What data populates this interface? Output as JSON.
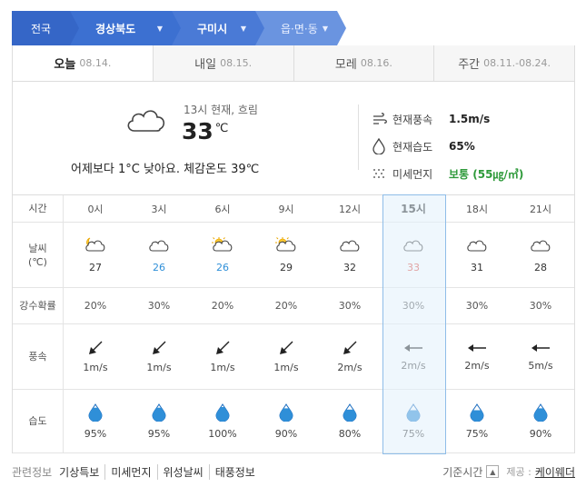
{
  "breadcrumb": {
    "home": "전국",
    "level1": "경상북도",
    "level2": "구미시",
    "level3": "읍·면·동"
  },
  "tabs": [
    {
      "label": "오늘",
      "date": "08.14."
    },
    {
      "label": "내일",
      "date": "08.15."
    },
    {
      "label": "모레",
      "date": "08.16."
    },
    {
      "label": "주간",
      "date": "08.11.-08.24."
    }
  ],
  "current": {
    "desc": "13시 현재, 흐림",
    "temp": "33",
    "unit": "℃",
    "compare": "어제보다 1°C 낮아요.  체감온도 39℃",
    "icon": "cloudy-icon"
  },
  "info": {
    "wind_label": "현재풍속",
    "wind_value": "1.5m/s",
    "humidity_label": "현재습도",
    "humidity_value": "65%",
    "dust_label": "미세먼지",
    "dust_value": "보통 (55㎍/㎥)"
  },
  "forecast": {
    "labels": {
      "time": "시간",
      "weather": "날씨\n(℃)",
      "rain": "강수확률",
      "wind": "풍속",
      "humidity": "습도"
    },
    "times": [
      "0시",
      "3시",
      "6시",
      "9시",
      "12시",
      "15시",
      "18시",
      "21시"
    ],
    "icons": [
      "cloudy-night-icon",
      "cloudy-icon",
      "partly-cloudy-icon",
      "partly-cloudy-icon",
      "cloudy-icon",
      "cloudy-icon",
      "cloudy-icon",
      "cloudy-icon"
    ],
    "temps": [
      "27",
      "26",
      "26",
      "29",
      "32",
      "33",
      "31",
      "28"
    ],
    "rain": [
      "20%",
      "30%",
      "20%",
      "20%",
      "30%",
      "30%",
      "30%",
      "30%"
    ],
    "wind_dir": [
      "sw",
      "sw",
      "sw",
      "sw",
      "sw",
      "w",
      "w",
      "w"
    ],
    "wind": [
      "1m/s",
      "1m/s",
      "1m/s",
      "1m/s",
      "2m/s",
      "2m/s",
      "2m/s",
      "5m/s"
    ],
    "humidity": [
      "95%",
      "95%",
      "100%",
      "90%",
      "80%",
      "75%",
      "75%",
      "90%"
    ],
    "humidity_level": [
      0.95,
      0.95,
      1.0,
      0.9,
      0.8,
      0.75,
      0.75,
      0.9
    ],
    "highlight_index": 5
  },
  "footer": {
    "related_label": "관련정보",
    "links": [
      "기상특보",
      "미세먼지",
      "위성날씨",
      "태풍정보"
    ],
    "standard": "기준시간",
    "source_label": "제공 :",
    "source": "케이웨더"
  },
  "colors": {
    "accent": "#4a7ad6",
    "cool": "#2f8fd8",
    "hot": "#e0463a",
    "good": "#2e9a3a"
  }
}
